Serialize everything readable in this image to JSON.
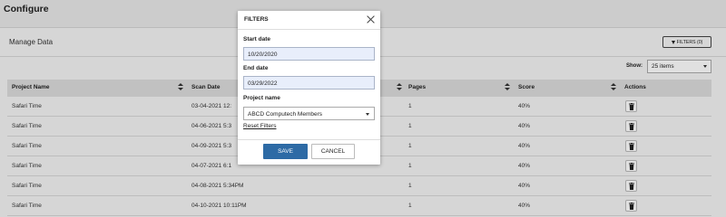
{
  "page": {
    "title": "Configure"
  },
  "card": {
    "title": "Manage Data",
    "filters_button": "FILTERS (0)",
    "show_label": "Show:",
    "show_value": "25 items"
  },
  "table": {
    "columns": [
      "Project Name",
      "Scan Date",
      "Pages",
      "Score",
      "Actions"
    ],
    "rows": [
      {
        "project": "Safari Time",
        "date": "03-04-2021 12:",
        "pages": "1",
        "score": "40%"
      },
      {
        "project": "Safari Time",
        "date": "04-06-2021 5:3",
        "pages": "1",
        "score": "40%"
      },
      {
        "project": "Safari Time",
        "date": "04-09-2021 5:3",
        "pages": "1",
        "score": "40%"
      },
      {
        "project": "Safari Time",
        "date": "04-07-2021 6:1",
        "pages": "1",
        "score": "40%"
      },
      {
        "project": "Safari Time",
        "date": "04-08-2021 5:34PM",
        "pages": "1",
        "score": "40%"
      },
      {
        "project": "Safari Time",
        "date": "04-10-2021 10:11PM",
        "pages": "1",
        "score": "40%"
      }
    ]
  },
  "modal": {
    "title": "FILTERS",
    "start_label": "Start date",
    "start_value": "10/20/2020",
    "end_label": "End date",
    "end_value": "03/29/2022",
    "project_label": "Project name",
    "project_value": "ABCD Computech Members",
    "reset_label": "Reset Filters",
    "save_label": "SAVE",
    "cancel_label": "CANCEL"
  }
}
